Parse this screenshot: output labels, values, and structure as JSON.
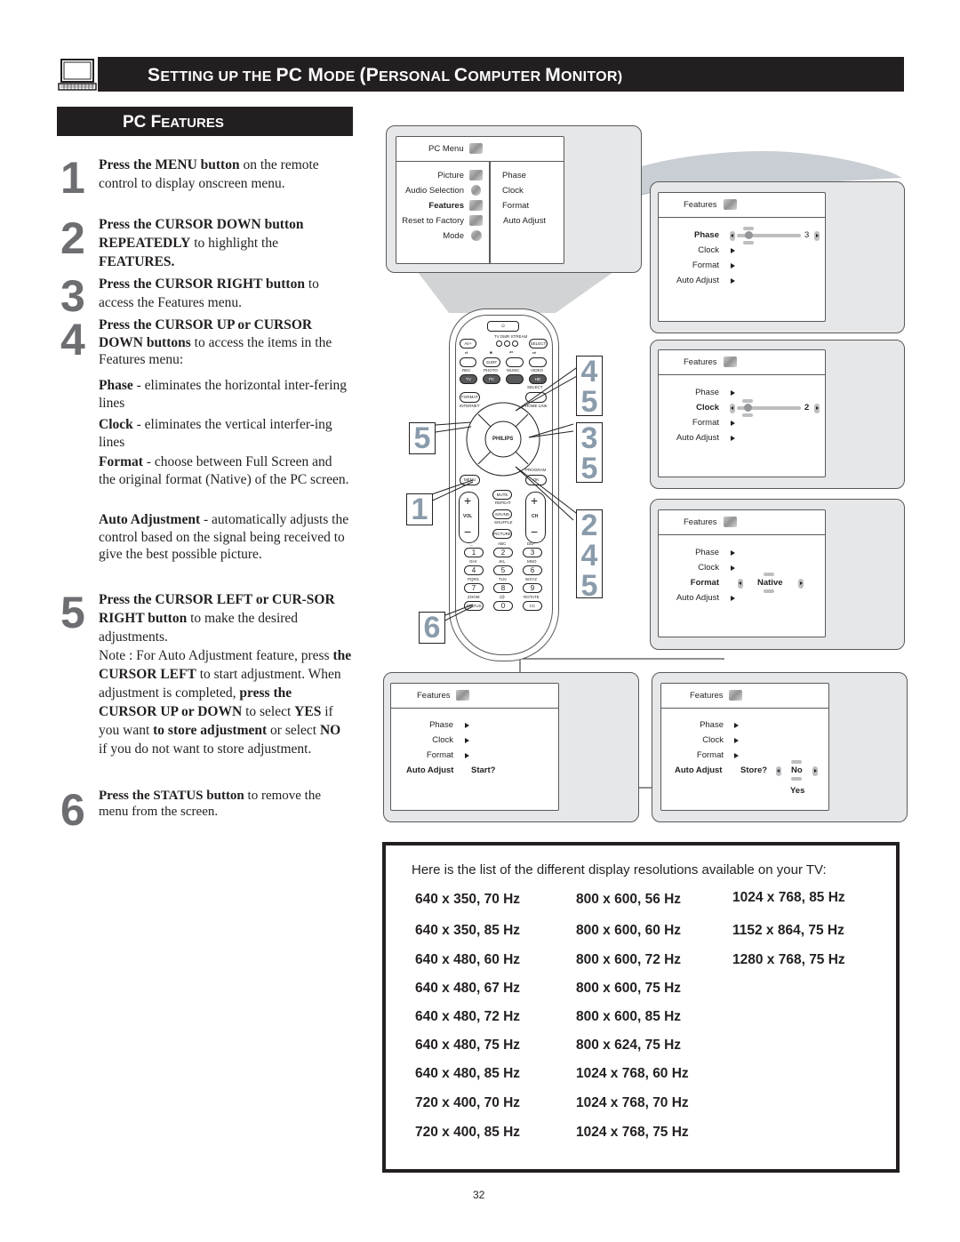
{
  "header": {
    "title_parts": [
      "S",
      "ETTING UP THE ",
      "PC M",
      "ODE ",
      "(P",
      "ERSONAL ",
      "C",
      "OMPUTER ",
      "M",
      "ONITOR)"
    ],
    "icon": "laptop-icon"
  },
  "section": {
    "title_parts": [
      "PC F",
      "EATURES"
    ]
  },
  "steps": [
    {
      "num": "1",
      "bold": "Press the MENU button",
      "text": " on the remote control to display onscreen menu."
    },
    {
      "num": "2",
      "bold": "Press the CURSOR DOWN button REPEATEDLY",
      "text": " to highlight the ",
      "bold2": "FEATURES."
    },
    {
      "num": "3",
      "bold": "Press the CURSOR RIGHT button",
      "text": " to access the Features menu."
    },
    {
      "num": "4",
      "bold": "Press the CURSOR UP or CURSOR DOWN buttons",
      "text": " to access the items in the Features menu:"
    },
    {
      "num": "5",
      "bold": "Press the CURSOR LEFT or CUR-SOR RIGHT button",
      "text": " to make the desired adjustments."
    },
    {
      "num": "6",
      "bold": "Press the STATUS button",
      "text": " to remove the menu from the screen."
    }
  ],
  "feature_descriptions": [
    {
      "term": "Phase",
      "text": " - eliminates the horizontal inter-fering lines"
    },
    {
      "term": "Clock",
      "text": " - eliminates the vertical interfer-ing lines"
    },
    {
      "term": "Format",
      "text": " - choose between Full Screen and the original format (Native) of the PC screen."
    },
    {
      "term": "Auto Adjustment",
      "text": " - automatically adjusts the control based on the signal being received to give the best possible picture."
    }
  ],
  "note": {
    "p1": "Note : For Auto Adjustment feature, press ",
    "b1": "the CURSOR LEFT",
    "p2": " to start adjustment. When adjustment is completed, ",
    "b2": "press the CURSOR UP or DOWN",
    "p3": " to select ",
    "b3": "YES",
    "p4": " if you want ",
    "b4": "to store adjustment",
    "p5": " or select ",
    "b5": "NO",
    "p6": " if you do not want to store adjustment."
  },
  "pc_menu": {
    "title": "PC Menu",
    "left_items": [
      "Picture",
      "Audio Selection",
      "Features",
      "Reset to Factory",
      "Mode"
    ],
    "highlighted": "Features",
    "right_items": [
      "Phase",
      "Clock",
      "Format",
      "Auto Adjust"
    ]
  },
  "features_menus": [
    {
      "title": "Features",
      "items": [
        "Phase",
        "Clock",
        "Format",
        "Auto Adjust"
      ],
      "active": "Phase",
      "value": "3"
    },
    {
      "title": "Features",
      "items": [
        "Phase",
        "Clock",
        "Format",
        "Auto Adjust"
      ],
      "active": "Clock",
      "value": "2"
    },
    {
      "title": "Features",
      "items": [
        "Phase",
        "Clock",
        "Format",
        "Auto Adjust"
      ],
      "active": "Format",
      "value": "Native"
    },
    {
      "title": "Features",
      "items": [
        "Phase",
        "Clock",
        "Format",
        "Auto Adjust"
      ],
      "active": "Auto Adjust",
      "value": "Start?"
    },
    {
      "title": "Features",
      "items": [
        "Phase",
        "Clock",
        "Format",
        "Auto Adjust"
      ],
      "active": "Auto Adjust",
      "prompt": "Store?",
      "value": "No",
      "alt_value": "Yes"
    }
  ],
  "remote": {
    "brand": "PHILIPS",
    "source_labels": [
      "TV",
      "DMR",
      "STREAM"
    ],
    "buttons": {
      "av": "AV+",
      "select": "SELECT",
      "surf": "SURF",
      "tv": "TV",
      "pc": "PC",
      "hd": "HD",
      "rec": "REC",
      "photo": "PHOTO",
      "music": "MUSIC",
      "video": "VIDEO",
      "format": "FORMAT",
      "internet": "INTERNET",
      "select2": "SELECT",
      "home_link": "HOME LINK",
      "menu": "MENU",
      "program": "PROGRAM",
      "ok": "OK",
      "mute": "MUTE",
      "repeat": "REPEAT",
      "sound": "SOUND",
      "shuffle": "SHUFFLE",
      "picture": "PICTURE",
      "vol": "VOL",
      "ch": "CH",
      "plus": "+",
      "minus": "−",
      "zoom": "ZOOM",
      "status": "STATUS",
      "rotate": "ROTATE",
      "cc": "CC"
    },
    "keypad": [
      {
        "key": "1",
        "sub": "._"
      },
      {
        "key": "2",
        "sub": "ABC"
      },
      {
        "key": "3",
        "sub": "DEF"
      },
      {
        "key": "4",
        "sub": "GHI"
      },
      {
        "key": "5",
        "sub": "JKL"
      },
      {
        "key": "6",
        "sub": "MNO"
      },
      {
        "key": "7",
        "sub": "PQRS"
      },
      {
        "key": "8",
        "sub": "TUV"
      },
      {
        "key": "9",
        "sub": "WXYZ"
      },
      {
        "key": "0",
        "sub": "/@"
      }
    ],
    "callouts": {
      "up": [
        "4",
        "5"
      ],
      "left": [
        "5"
      ],
      "right": [
        "3",
        "5"
      ],
      "menu": [
        "1"
      ],
      "down": [
        "2",
        "4",
        "5"
      ],
      "status": [
        "6"
      ]
    }
  },
  "resolutions": {
    "intro": "Here is the list of the different display resolutions available on your TV:",
    "columns": [
      [
        "640 x 350, 70 Hz",
        "640 x 350, 85 Hz",
        "640 x 480, 60 Hz",
        "640 x 480, 67 Hz",
        "640 x 480, 72 Hz",
        "640 x 480, 75 Hz",
        "640 x 480, 85 Hz",
        "720 x 400, 70 Hz",
        "720 x 400, 85 Hz"
      ],
      [
        "800 x 600, 56 Hz",
        "800 x 600, 60 Hz",
        "800 x 600, 72 Hz",
        "800 x 600, 75 Hz",
        "800 x 600, 85 Hz",
        "800 x 624, 75 Hz",
        "1024 x 768, 60 Hz",
        "1024 x 768, 70 Hz",
        "1024 x 768, 75 Hz"
      ],
      [
        "1024 x 768, 85 Hz",
        "1152 x 864, 75 Hz",
        "1280 x 768, 75 Hz"
      ]
    ]
  },
  "page_number": "32",
  "colors": {
    "header_bg": "#231f20",
    "step_number": "#6d6e71",
    "panel_bg": "#e6e7e8",
    "callout_number": "#8a9bab"
  }
}
